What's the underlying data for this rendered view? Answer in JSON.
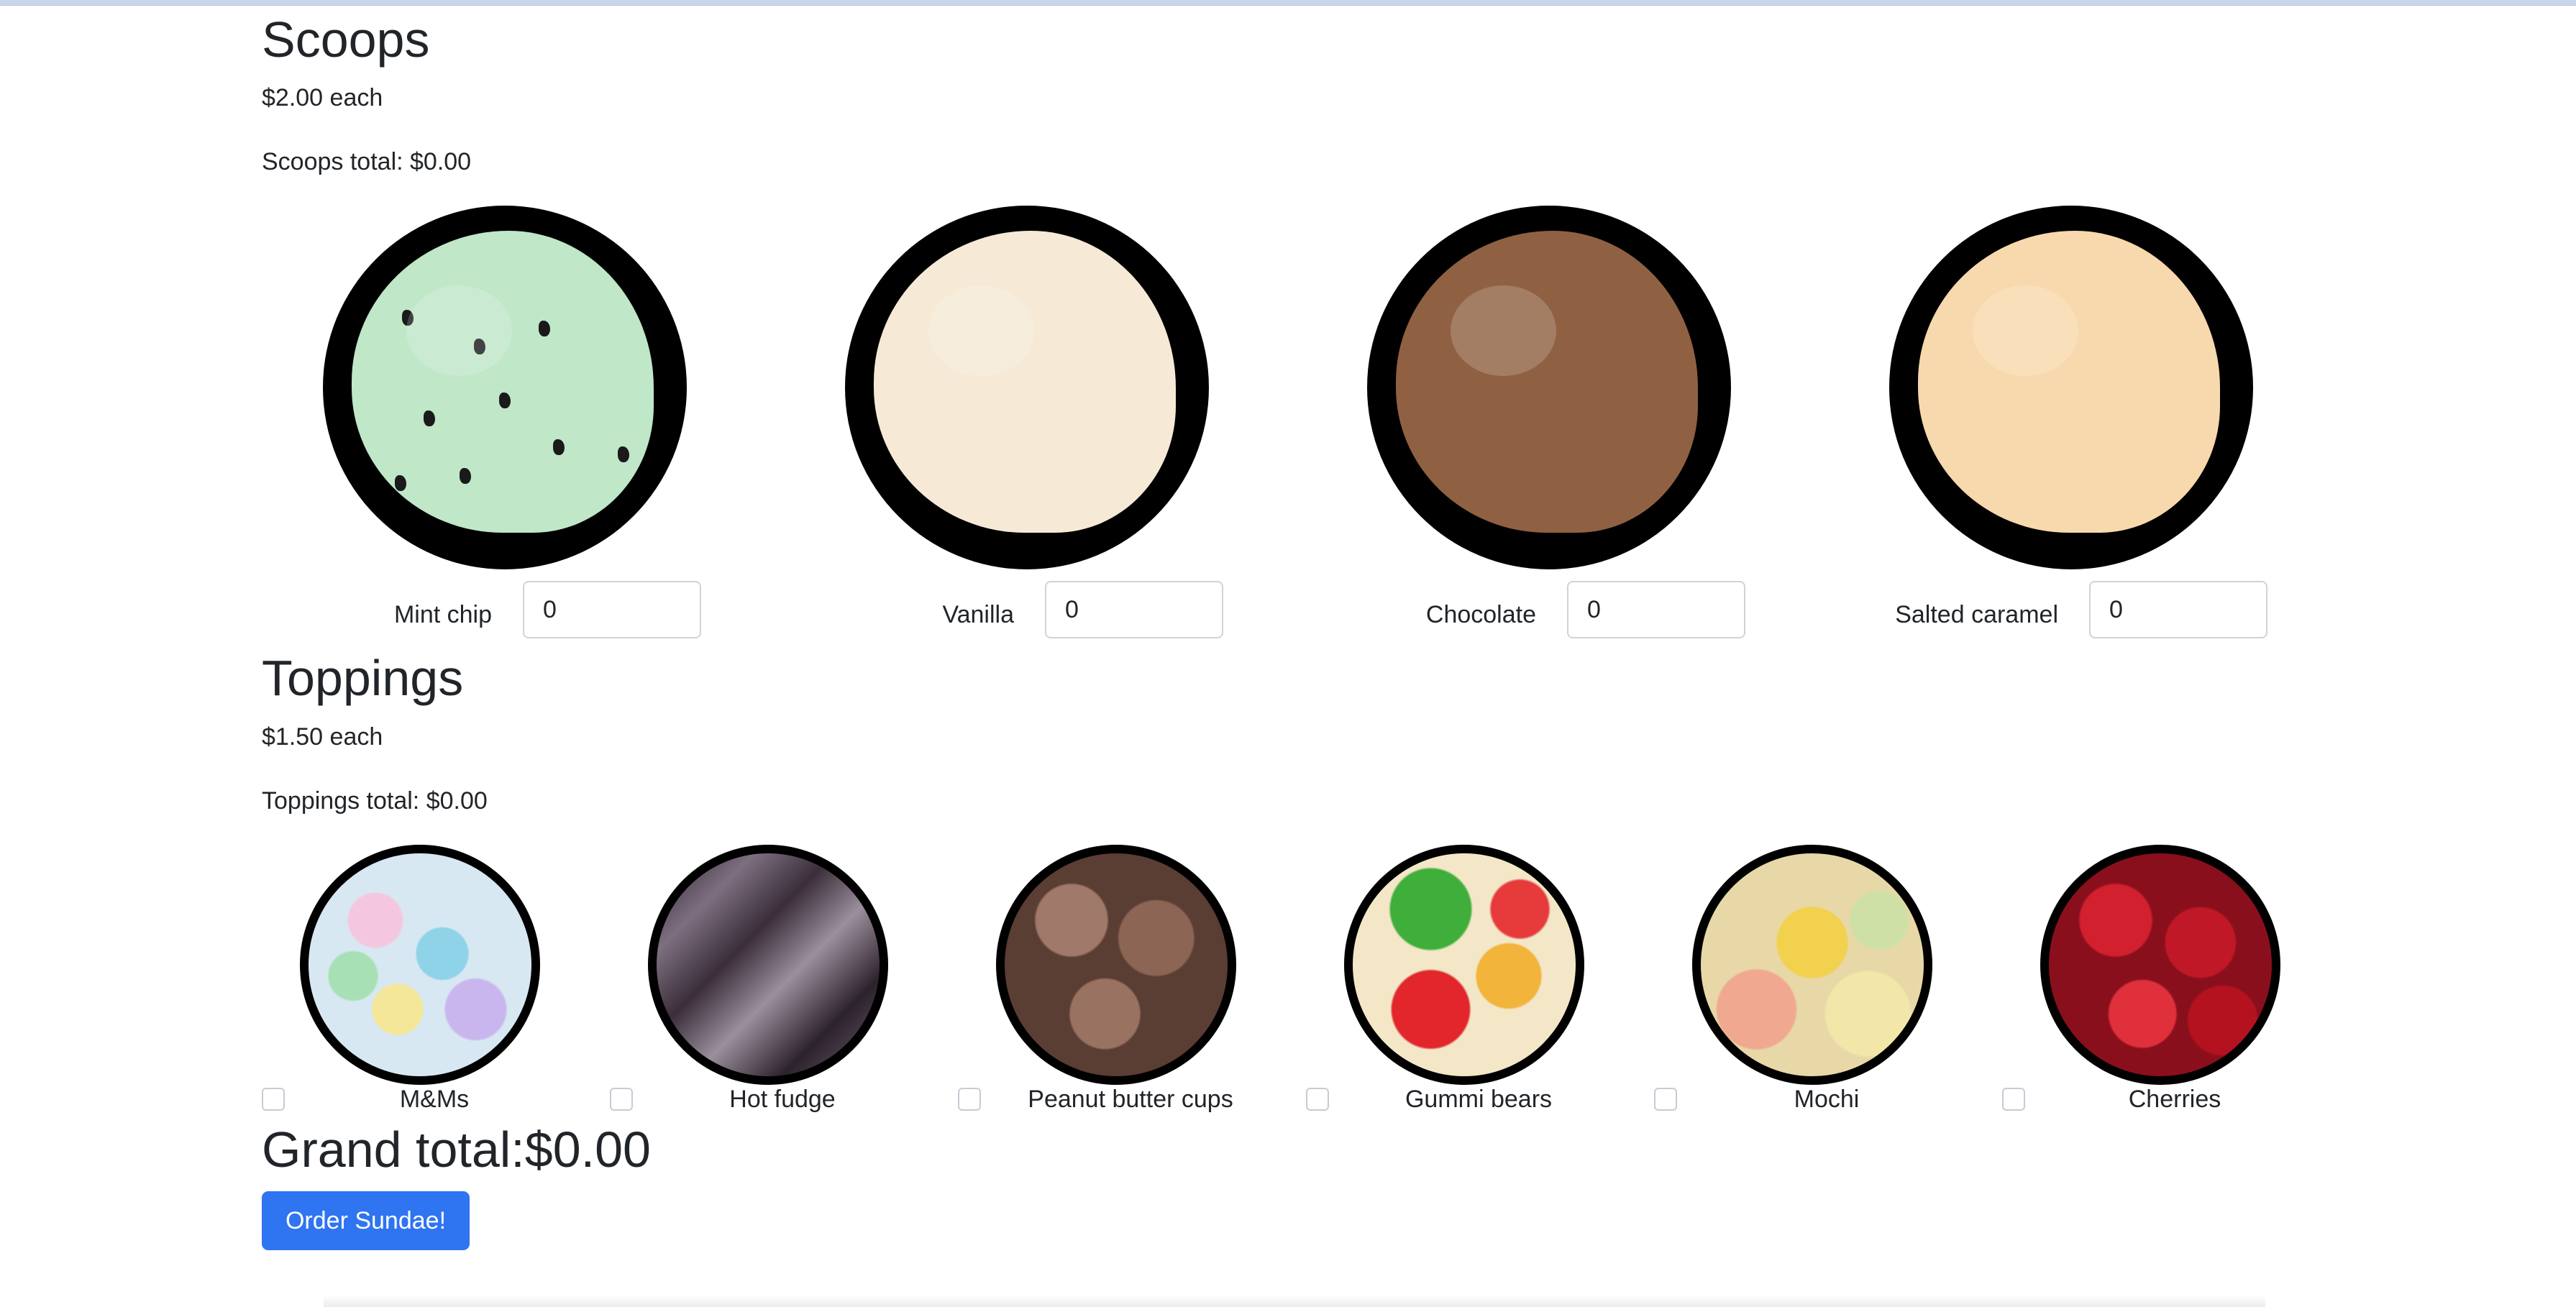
{
  "scoops": {
    "title": "Scoops",
    "price": "$2.00 each",
    "total_label": "Scoops total: $0.00",
    "items": [
      {
        "name": "Mint chip",
        "value": "0",
        "color": "#bfe7c8"
      },
      {
        "name": "Vanilla",
        "value": "0",
        "color": "#f6ead6"
      },
      {
        "name": "Chocolate",
        "value": "0",
        "color": "#8f6142"
      },
      {
        "name": "Salted caramel",
        "value": "0",
        "color": "#f8d9ad"
      }
    ]
  },
  "toppings": {
    "title": "Toppings",
    "price": "$1.50 each",
    "total_label": "Toppings total: $0.00",
    "items": [
      {
        "name": "M&Ms",
        "checked": false
      },
      {
        "name": "Hot fudge",
        "checked": false
      },
      {
        "name": "Peanut butter cups",
        "checked": false
      },
      {
        "name": "Gummi bears",
        "checked": false
      },
      {
        "name": "Mochi",
        "checked": false
      },
      {
        "name": "Cherries",
        "checked": false
      }
    ]
  },
  "grand_total": "Grand total:$0.00",
  "order_button": "Order Sundae!",
  "colors": {
    "accent": "#2f74f1",
    "text": "#212529"
  }
}
